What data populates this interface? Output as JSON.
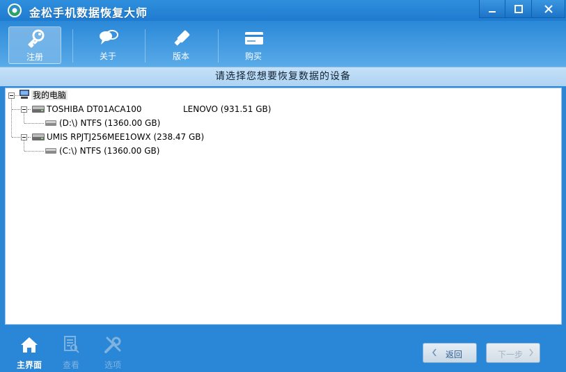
{
  "window": {
    "title": "金松手机数据恢复大师",
    "controls": [
      "minimize",
      "maximize",
      "close"
    ]
  },
  "toolbar": {
    "items": [
      {
        "label": "注册",
        "icon": "key-icon",
        "active": true
      },
      {
        "label": "关于",
        "icon": "chat-bubble-icon",
        "active": false
      },
      {
        "label": "版本",
        "icon": "usb-stick-icon",
        "active": false
      },
      {
        "label": "购买",
        "icon": "credit-card-icon",
        "active": false
      }
    ]
  },
  "header": {
    "title": "请选择您想要恢复数据的设备"
  },
  "tree": {
    "root": {
      "label": "我的电脑",
      "icon": "computer-icon"
    },
    "disks": [
      {
        "model": "TOSHIBA DT01ACA100",
        "vendor": "LENOVO (931.51 GB)",
        "partitions": [
          {
            "label": "(D:\\) NTFS (1360.00 GB)"
          }
        ]
      },
      {
        "model": "UMIS RPJTJ256MEE1OWX (238.47 GB)",
        "vendor": "",
        "partitions": [
          {
            "label": "(C:\\) NTFS (1360.00 GB)"
          }
        ]
      }
    ]
  },
  "bottom": {
    "tools": [
      {
        "label": "主界面",
        "icon": "home-icon",
        "enabled": true
      },
      {
        "label": "查看",
        "icon": "document-search-icon",
        "enabled": false
      },
      {
        "label": "选项",
        "icon": "tools-icon",
        "enabled": false
      }
    ],
    "back_label": "返回",
    "next_label": "下一步"
  },
  "colors": {
    "primary": "#2b86d4",
    "header": "#b8d9f4",
    "panel": "#ffffff"
  }
}
